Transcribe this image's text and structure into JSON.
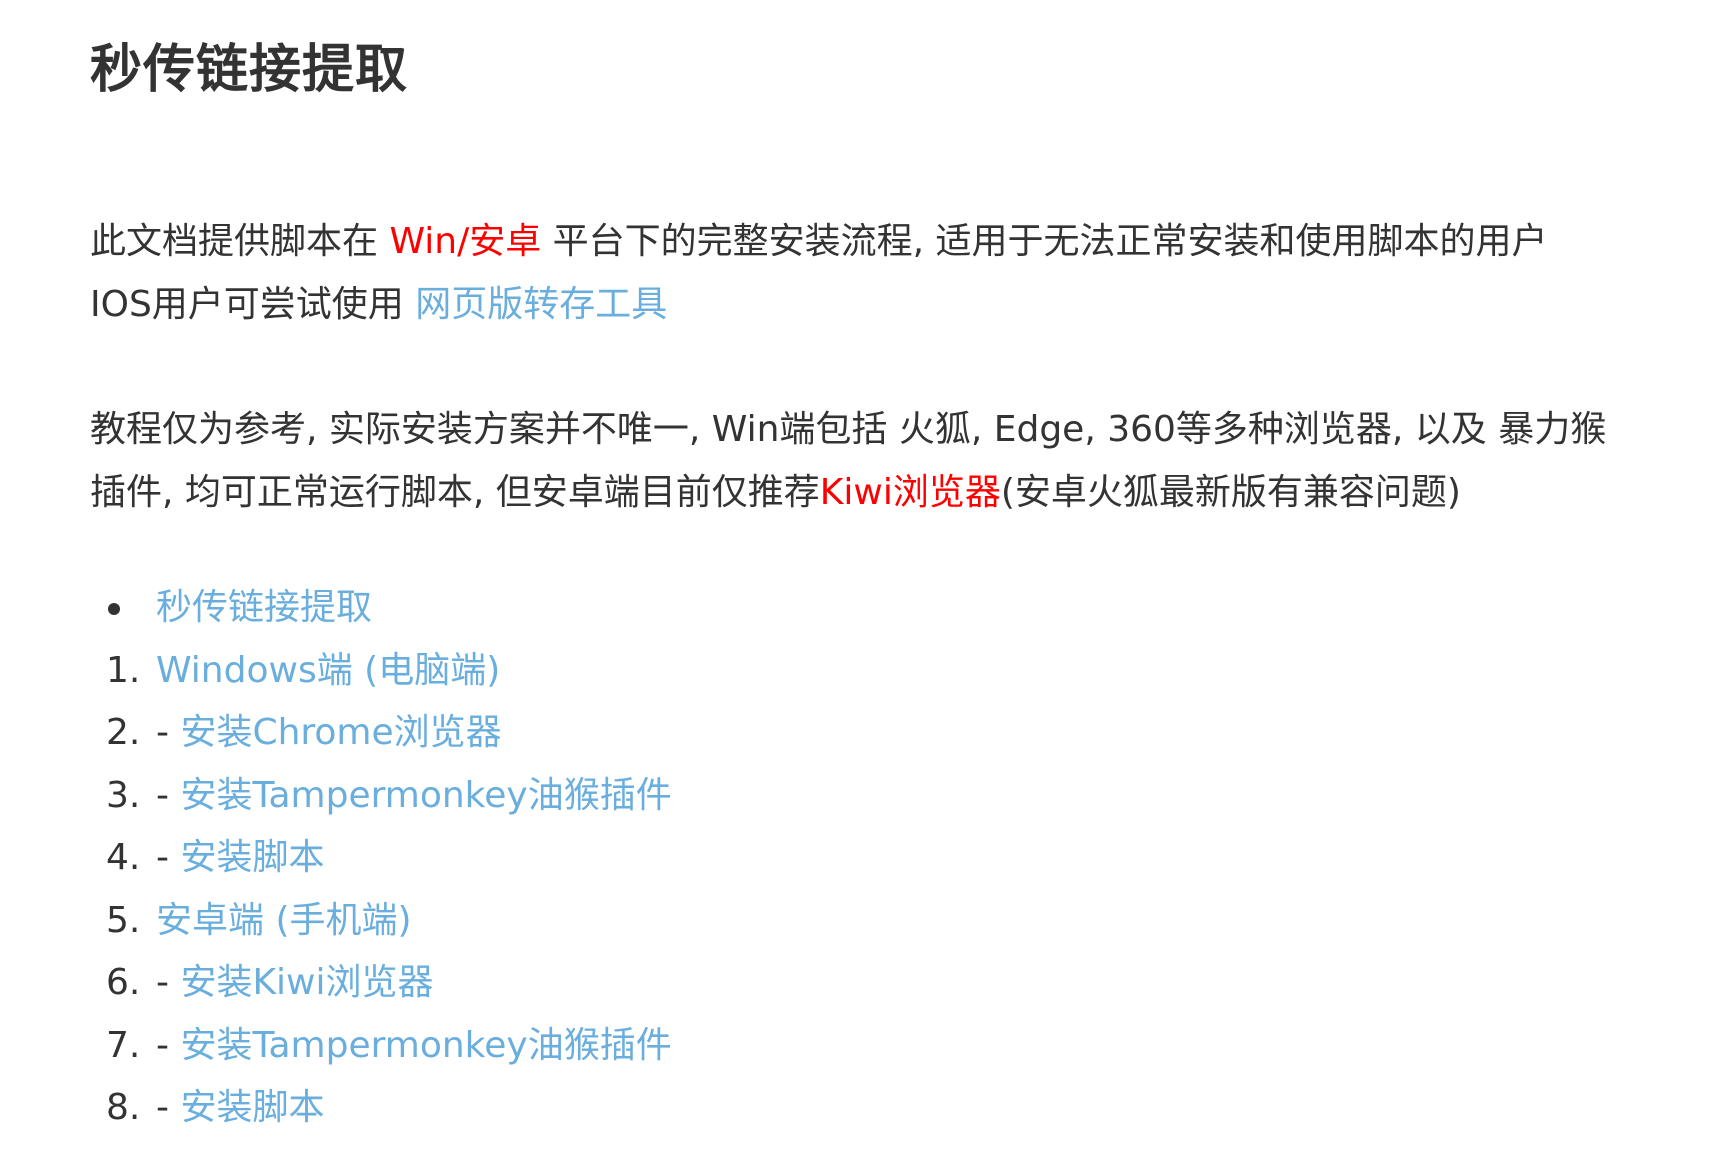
{
  "title": "秒传链接提取",
  "intro": {
    "line1_prefix": "此文档提供脚本在 ",
    "line1_highlight": "Win/安卓",
    "line1_suffix": " 平台下的完整安装流程, 适用于无法正常安装和使用脚本的用户",
    "line2_prefix": "IOS用户可尝试使用 ",
    "line2_link": "网页版转存工具"
  },
  "notice": {
    "line1": "教程仅为参考, 实际安装方案并不唯一, Win端包括 火狐, Edge, 360等多种浏览器, 以及 暴力猴",
    "line2_prefix": "插件, 均可正常运行脚本, 但安卓端目前仅推荐",
    "line2_highlight": "Kiwi浏览器",
    "line2_suffix": "(安卓火狐最新版有兼容问题)"
  },
  "toc": {
    "bullet_item": "秒传链接提取",
    "items": [
      {
        "number": "1.",
        "dash": "",
        "label": "Windows端 (电脑端)"
      },
      {
        "number": "2.",
        "dash": "- ",
        "label": "安装Chrome浏览器"
      },
      {
        "number": "3.",
        "dash": "- ",
        "label": "安装Tampermonkey油猴插件"
      },
      {
        "number": "4.",
        "dash": "- ",
        "label": "安装脚本"
      },
      {
        "number": "5.",
        "dash": "",
        "label": "安卓端 (手机端)"
      },
      {
        "number": "6.",
        "dash": "- ",
        "label": "安装Kiwi浏览器"
      },
      {
        "number": "7.",
        "dash": "- ",
        "label": "安装Tampermonkey油猴插件"
      },
      {
        "number": "8.",
        "dash": "- ",
        "label": "安装脚本"
      }
    ]
  },
  "colors": {
    "text": "#333333",
    "highlight": "#ff0000",
    "link": "#6aaede"
  }
}
